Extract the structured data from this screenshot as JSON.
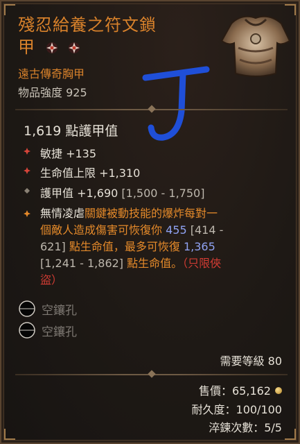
{
  "item": {
    "name_line1": "殘忍給養之符文鎖",
    "name_line2": "甲",
    "type": "遠古傳奇胸甲",
    "power": "物品強度 925",
    "armor_value": "1,619 點護甲值"
  },
  "stats": [
    {
      "text": "敏捷 +135",
      "bullet_color": "#b9332b"
    },
    {
      "text": "生命值上限 +1,310",
      "bullet_color": "#b9332b"
    },
    {
      "text": "護甲值 +1,690",
      "range": "[1,500 - 1,750]",
      "bullet_color": "#8a8275"
    }
  ],
  "legendary": {
    "lines": [
      [
        {
          "t": "無情凌虐",
          "c": "white"
        },
        {
          "t": "關鍵被動技能的爆炸每對一",
          "c": "orange"
        }
      ],
      [
        {
          "t": "個敵人造成傷害可恢復你 ",
          "c": "orange"
        },
        {
          "t": "455",
          "c": "blue"
        },
        {
          "t": " [414 -",
          "c": "gray"
        }
      ],
      [
        {
          "t": "621] ",
          "c": "gray"
        },
        {
          "t": "點生命值，最多可恢復 ",
          "c": "orange"
        },
        {
          "t": "1,365",
          "c": "blue"
        }
      ],
      [
        {
          "t": "[1,241 - 1,862] ",
          "c": "gray"
        },
        {
          "t": "點生命值。",
          "c": "orange"
        },
        {
          "t": "（只限俠",
          "c": "red"
        }
      ],
      [
        {
          "t": "盜）",
          "c": "red"
        }
      ]
    ]
  },
  "sockets": [
    "空鑲孔",
    "空鑲孔"
  ],
  "requirement": "需要等級 80",
  "footer": {
    "sell": "售價：65,162",
    "durability": "耐久度：100/100",
    "temper": "淬鍊次數：5/5"
  },
  "colors": {
    "title": "#d9822b",
    "legendary_text": "#e58a2a",
    "value_blue": "#8fa2f2",
    "class_red": "#d23c33",
    "annotation_blue": "#1f4fd8"
  }
}
